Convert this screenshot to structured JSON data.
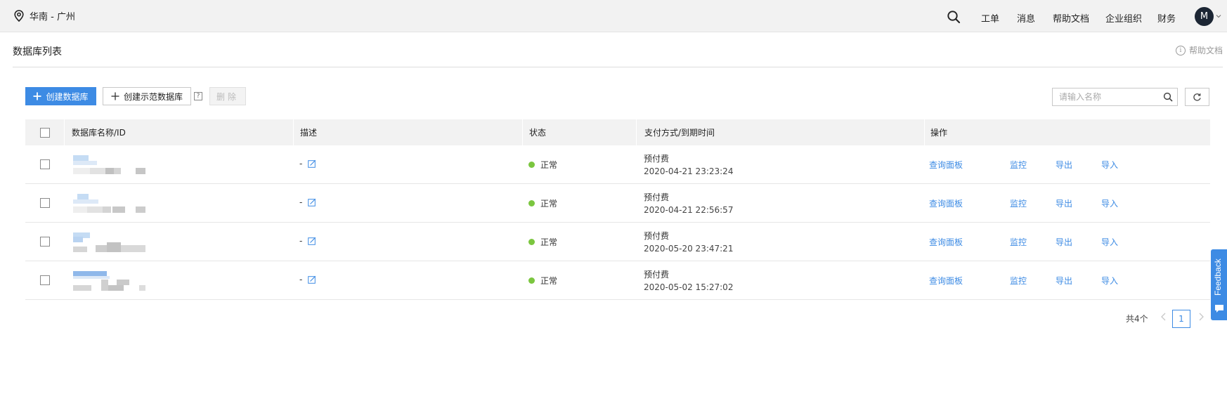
{
  "topbar": {
    "region": "华南 - 广州",
    "nav": [
      "工单",
      "消息",
      "帮助文档",
      "企业组织",
      "财务"
    ],
    "avatar": "M"
  },
  "header": {
    "title": "数据库列表",
    "help": "帮助文档"
  },
  "toolbar": {
    "create_label": "创建数据库",
    "create_demo_label": "创建示范数据库",
    "help_mark": "?",
    "delete_label": "删除",
    "search_placeholder": "请输入名称"
  },
  "table": {
    "columns": [
      "数据库名称/ID",
      "描述",
      "状态",
      "支付方式/到期时间",
      "操作"
    ],
    "rows": [
      {
        "desc": "-",
        "status": "正常",
        "pay": "预付费",
        "expire": "2020-04-21 23:23:24"
      },
      {
        "desc": "-",
        "status": "正常",
        "pay": "预付费",
        "expire": "2020-04-21 22:56:57"
      },
      {
        "desc": "-",
        "status": "正常",
        "pay": "预付费",
        "expire": "2020-05-20 23:47:21"
      },
      {
        "desc": "-",
        "status": "正常",
        "pay": "预付费",
        "expire": "2020-05-02 15:27:02"
      }
    ],
    "actions": [
      "查询面板",
      "监控",
      "导出",
      "导入"
    ]
  },
  "pagination": {
    "total": "共4个",
    "current": "1"
  },
  "feedback": "Feedback",
  "colors": {
    "accent": "#3d8be4",
    "status_ok": "#7bc63f",
    "avatar_bg": "#1c2634"
  }
}
